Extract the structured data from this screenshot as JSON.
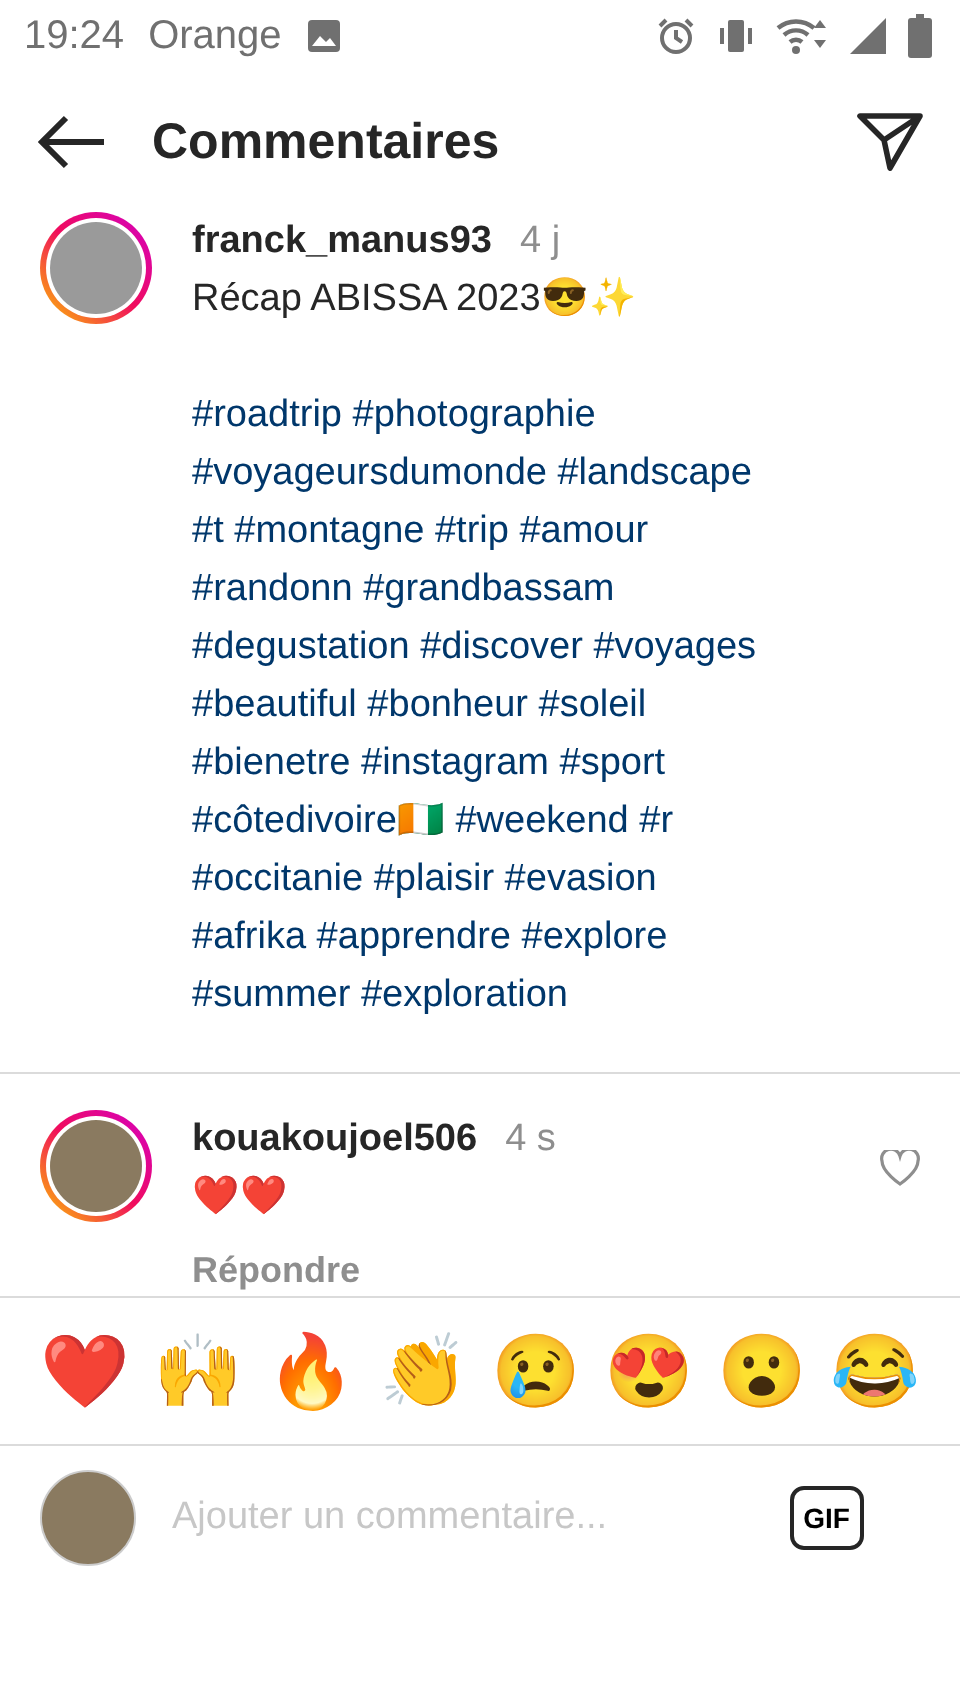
{
  "status_bar": {
    "time": "19:24",
    "carrier": "Orange"
  },
  "header": {
    "title": "Commentaires"
  },
  "post": {
    "username": "franck_manus93",
    "age": "4 j",
    "caption": "Récap ABISSA 2023😎✨",
    "hashtag_lines": [
      "#roadtrip #photographie",
      "#voyageursdumonde #landscape",
      "#t #montagne #trip #amour",
      "#randonn #grandbassam",
      "#degustation #discover #voyages",
      "#beautiful #bonheur #soleil",
      "#bienetre #instagram #sport",
      "#côtedivoire🇨🇮 #weekend #r",
      "#occitanie #plaisir #evasion",
      "#afrika #apprendre #explore",
      "#summer #exploration"
    ]
  },
  "comments": [
    {
      "username": "kouakoujoel506",
      "age": "4 s",
      "text": "❤️❤️",
      "reply": "Répondre",
      "liked": false
    }
  ],
  "reactions": [
    "❤️",
    "🙌",
    "🔥",
    "👏",
    "😢",
    "😍",
    "😮",
    "😂"
  ],
  "composer": {
    "placeholder": "Ajouter un commentaire...",
    "gif": "GIF"
  }
}
